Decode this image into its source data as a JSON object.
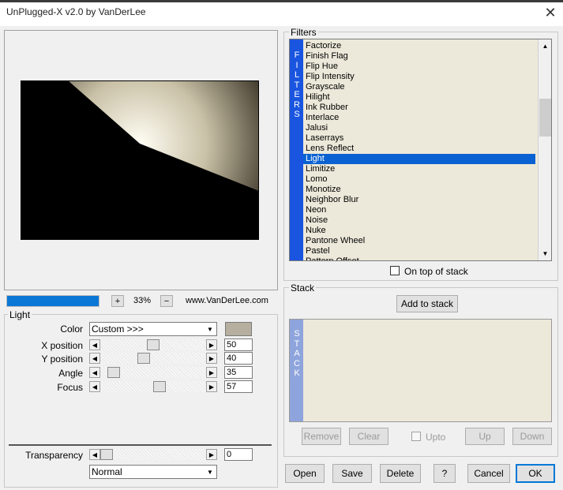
{
  "window": {
    "title": "UnPlugged-X v2.0 by VanDerLee",
    "close_glyph": "✕"
  },
  "preview": {
    "zoom": "33%",
    "zoom_in": "+",
    "zoom_out": "−",
    "website": "www.VanDerLee.com",
    "progress": 1.0
  },
  "light": {
    "group_label": "Light",
    "color_label": "Color",
    "color_value": "Custom >>>",
    "swatch_color": "#b6af9f",
    "sliders": [
      {
        "label": "X position",
        "value": "50",
        "fraction": 0.5
      },
      {
        "label": "Y position",
        "value": "40",
        "fraction": 0.4
      },
      {
        "label": "Angle",
        "value": "35",
        "fraction": 0.08
      },
      {
        "label": "Focus",
        "value": "57",
        "fraction": 0.57
      }
    ],
    "transparency_label": "Transparency",
    "transparency_value": "0",
    "transparency_fraction": 0.0,
    "blend_mode": "Normal"
  },
  "filters": {
    "group_label": "Filters",
    "side_label": [
      "F",
      "I",
      "L",
      "T",
      "E",
      "R",
      "S"
    ],
    "items": [
      "Factorize",
      "Finish Flag",
      "Flip Hue",
      "Flip Intensity",
      "Grayscale",
      "Hilight",
      "Ink Rubber",
      "Interlace",
      "Jalusi",
      "Laserrays",
      "Lens Reflect",
      "Light",
      "Limitize",
      "Lomo",
      "Monotize",
      "Neighbor Blur",
      "Neon",
      "Noise",
      "Nuke",
      "Pantone Wheel",
      "Pastel",
      "Pattern Offset"
    ],
    "selected": "Light",
    "on_top_label": "On top of stack"
  },
  "stack": {
    "group_label": "Stack",
    "add_label": "Add to stack",
    "side_label": [
      "S",
      "T",
      "A",
      "C",
      "K"
    ],
    "remove_label": "Remove",
    "clear_label": "Clear",
    "upto_label": "Upto",
    "up_label": "Up",
    "down_label": "Down"
  },
  "buttons": {
    "open": "Open",
    "save": "Save",
    "delete": "Delete",
    "help": "?",
    "cancel": "Cancel",
    "ok": "OK"
  },
  "colors": {
    "selection": "#0a62d2",
    "filters_bar": "#1a55e0",
    "stack_bar": "#8ea4dc",
    "list_bg": "#ede9da",
    "progress": "#0a77d6"
  }
}
